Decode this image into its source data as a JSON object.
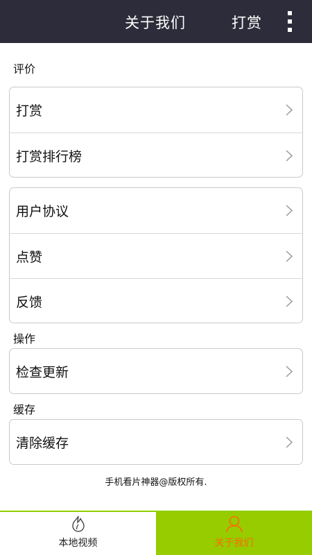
{
  "header": {
    "title": "关于我们",
    "reward_label": "打赏",
    "more_icon": "more-vertical-icon"
  },
  "sections": {
    "rating_label": "评价",
    "operation_label": "操作",
    "cache_label": "缓存"
  },
  "groups": {
    "rating": [
      "打赏",
      "打赏排行榜"
    ],
    "misc": [
      "用户协议",
      "点赞",
      "反馈"
    ],
    "operation": [
      "检查更新"
    ],
    "cache": [
      "清除缓存"
    ]
  },
  "footer_note": "手机看片神器@版权所有.",
  "tabs": [
    {
      "label": "本地视频",
      "icon": "flame-icon",
      "active": false
    },
    {
      "label": "关于我们",
      "icon": "person-icon",
      "active": true
    }
  ],
  "colors": {
    "header_bg": "#2d2c3a",
    "tab_active_bg": "#96cc00",
    "tab_active_text": "#ff6a00"
  }
}
